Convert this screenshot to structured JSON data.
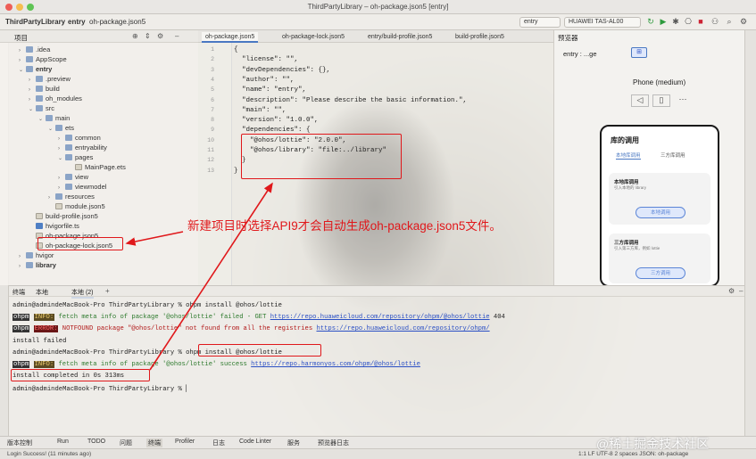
{
  "window": {
    "title": "ThirdPartyLibrary – oh-package.json5 [entry]"
  },
  "toolbar": {
    "breadcrumbs": [
      "ThirdPartyLibrary",
      "entry",
      "oh-package.json5"
    ],
    "module_select": "entry",
    "device_select": "HUAWEI TAS-AL00"
  },
  "project": {
    "title": "项目",
    "items": [
      {
        "label": ".idea",
        "depth": 1,
        "type": "folder",
        "arrow": "›"
      },
      {
        "label": "AppScope",
        "depth": 1,
        "type": "folder",
        "arrow": "›"
      },
      {
        "label": "entry",
        "depth": 1,
        "type": "folder",
        "arrow": "⌄",
        "bold": true
      },
      {
        "label": ".preview",
        "depth": 2,
        "type": "folder",
        "arrow": "›"
      },
      {
        "label": "build",
        "depth": 2,
        "type": "folder",
        "arrow": "›"
      },
      {
        "label": "oh_modules",
        "depth": 2,
        "type": "folder",
        "arrow": "›"
      },
      {
        "label": "src",
        "depth": 2,
        "type": "folder",
        "arrow": "⌄"
      },
      {
        "label": "main",
        "depth": 3,
        "type": "folder",
        "arrow": "⌄"
      },
      {
        "label": "ets",
        "depth": 4,
        "type": "folder",
        "arrow": "⌄"
      },
      {
        "label": "common",
        "depth": 5,
        "type": "folder",
        "arrow": "›"
      },
      {
        "label": "entryability",
        "depth": 5,
        "type": "folder",
        "arrow": "›"
      },
      {
        "label": "pages",
        "depth": 5,
        "type": "folder",
        "arrow": "⌄"
      },
      {
        "label": "MainPage.ets",
        "depth": 6,
        "type": "file",
        "arrow": ""
      },
      {
        "label": "view",
        "depth": 5,
        "type": "folder",
        "arrow": "›"
      },
      {
        "label": "viewmodel",
        "depth": 5,
        "type": "folder",
        "arrow": "›"
      },
      {
        "label": "resources",
        "depth": 4,
        "type": "folder",
        "arrow": "›"
      },
      {
        "label": "module.json5",
        "depth": 4,
        "type": "file",
        "arrow": ""
      },
      {
        "label": "build-profile.json5",
        "depth": 2,
        "type": "file",
        "arrow": ""
      },
      {
        "label": "hvigorfile.ts",
        "depth": 2,
        "type": "ts",
        "arrow": ""
      },
      {
        "label": "oh-package.json5",
        "depth": 2,
        "type": "file",
        "arrow": ""
      },
      {
        "label": "oh-package-lock.json5",
        "depth": 2,
        "type": "file",
        "arrow": ""
      },
      {
        "label": "hvigor",
        "depth": 1,
        "type": "folder",
        "arrow": "›"
      },
      {
        "label": "library",
        "depth": 1,
        "type": "folder",
        "arrow": "›",
        "bold": true
      }
    ]
  },
  "editor": {
    "tabs": [
      "oh-package.json5",
      "oh-package-lock.json5",
      "entry/build-profile.json5",
      "build-profile.json5"
    ],
    "active_tab": 0,
    "lines": [
      {
        "n": "1",
        "text": "{"
      },
      {
        "n": "2",
        "text": "  \"license\": \"\","
      },
      {
        "n": "3",
        "text": "  \"devDependencies\": {},"
      },
      {
        "n": "4",
        "text": "  \"author\": \"\","
      },
      {
        "n": "5",
        "text": "  \"name\": \"entry\","
      },
      {
        "n": "6",
        "text": "  \"description\": \"Please describe the basic information.\","
      },
      {
        "n": "7",
        "text": "  \"main\": \"\","
      },
      {
        "n": "8",
        "text": "  \"version\": \"1.0.0\","
      },
      {
        "n": "9",
        "text": "  \"dependencies\": {"
      },
      {
        "n": "10",
        "text": "    \"@ohos/lottie\": \"2.0.0\","
      },
      {
        "n": "11",
        "text": "    \"@ohos/library\": \"file:../library\""
      },
      {
        "n": "12",
        "text": "  }"
      },
      {
        "n": "13",
        "text": "}"
      }
    ]
  },
  "previewer": {
    "title": "预览器",
    "page": "entry : ...ge",
    "device": "Phone (medium)",
    "app_title": "库的调用",
    "tabs": [
      "本地库调用",
      "三方库调用"
    ],
    "card1_title": "本地库调用",
    "card1_sub": "引入本地的 library",
    "card1_button": "本地调用",
    "card2_title": "三方库调用",
    "card2_sub": "引入第三方库，例如 lottie",
    "card2_button": "三方调用"
  },
  "terminal": {
    "tabs": [
      "终端",
      "本地",
      "本地 (2)"
    ],
    "lines": [
      {
        "type": "cmd",
        "prompt": "admin@admindeMacBook-Pro ThirdPartyLibrary % ",
        "text": "ohpm install @ohos/lottie"
      },
      {
        "type": "log",
        "tag": "INFO:",
        "tagtype": "info",
        "text": " fetch meta info of package '@ohos/lottie' failed - GET ",
        "link": "https://repo.huaweicloud.com/repository/ohpm/@ohos/lottie",
        "tail": " 404"
      },
      {
        "type": "log",
        "tag": "ERROR:",
        "tagtype": "err",
        "text": " NOTFOUND package \"@ohos/lottie\" not found from all the registries ",
        "link": "https://repo.huaweicloud.com/repository/ohpm/",
        "tail": ""
      },
      {
        "type": "plain",
        "text": "install failed"
      },
      {
        "type": "cmd",
        "prompt": "admin@admindeMacBook-Pro ThirdPartyLibrary % ",
        "text": "ohpm install @ohos/lottie"
      },
      {
        "type": "log",
        "tag": "INFO:",
        "tagtype": "info",
        "text": " fetch meta info of package '@ohos/lottie' success ",
        "link": "https://repo.harmonyos.com/ohpm/@ohos/lottie",
        "tail": ""
      },
      {
        "type": "plain",
        "text": "install completed in 0s 313ms"
      },
      {
        "type": "cmd",
        "prompt": "admin@admindeMacBook-Pro ThirdPartyLibrary % ",
        "text": ""
      }
    ],
    "tag_prefix": "ohpm"
  },
  "bottom_tools": [
    "版本控制",
    "Run",
    "TODO",
    "问题",
    "终端",
    "Profiler",
    "日志",
    "Code Linter",
    "服务",
    "预览器日志"
  ],
  "status": {
    "left": "Login Success! (11 minutes ago)",
    "right": "1:1  LF  UTF-8  2 spaces  JSON: oh-package"
  },
  "annotation": "新建项目时选择API9才会自动生成oh-package.json5文件。",
  "watermark": "@稀土掘金技术社区",
  "colors": {
    "accent": "#4a78c2",
    "annotation": "#e0181b",
    "run": "#2d9a3d"
  }
}
